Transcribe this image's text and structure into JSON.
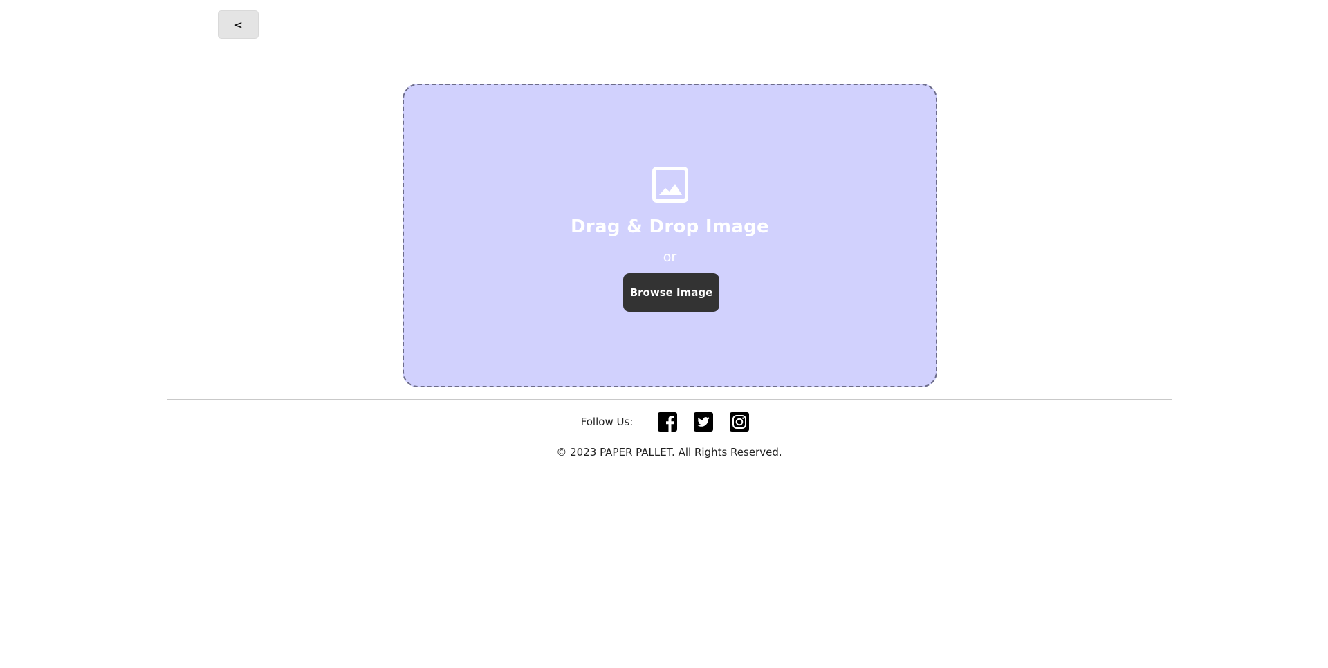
{
  "nav": {
    "back_label": "<"
  },
  "upload": {
    "icon": "image-icon",
    "title": "Drag & Drop Image",
    "or_text": "or",
    "browse_label": "Browse Image",
    "background_color": "#d1d1fd",
    "button_color": "#333333"
  },
  "footer": {
    "follow_label": "Follow Us:",
    "social_icons": [
      "facebook-icon",
      "twitter-icon",
      "instagram-icon"
    ],
    "copyright": "© 2023 PAPER PALLET. All Rights Reserved."
  }
}
